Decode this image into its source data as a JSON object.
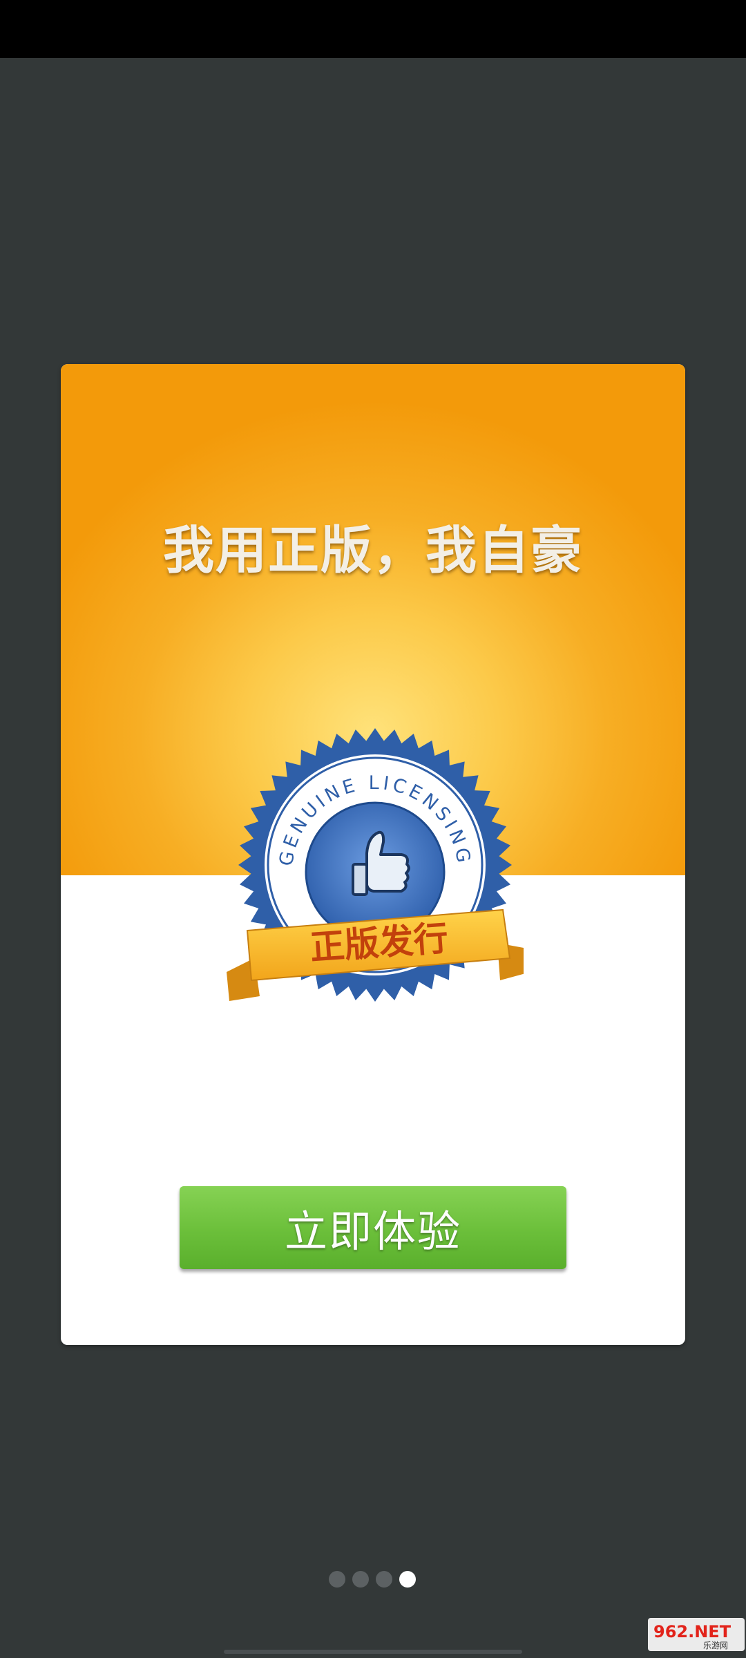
{
  "headline": "我用正版，我自豪",
  "badge": {
    "ring_text": "GENUINE LICENSING",
    "ribbon_text": "正版发行",
    "icon": "thumbs-up-icon"
  },
  "cta_label": "立即体验",
  "pager": {
    "total": 4,
    "active_index": 3
  },
  "watermark_text": "962.NET",
  "watermark_subtext": "乐游网",
  "colors": {
    "background": "#333838",
    "banner_top": "#f39a0a",
    "banner_glow": "#ffe27a",
    "button_green": "#6bbf3a",
    "badge_blue": "#2f5fa8",
    "ribbon_orange": "#f5a623"
  }
}
